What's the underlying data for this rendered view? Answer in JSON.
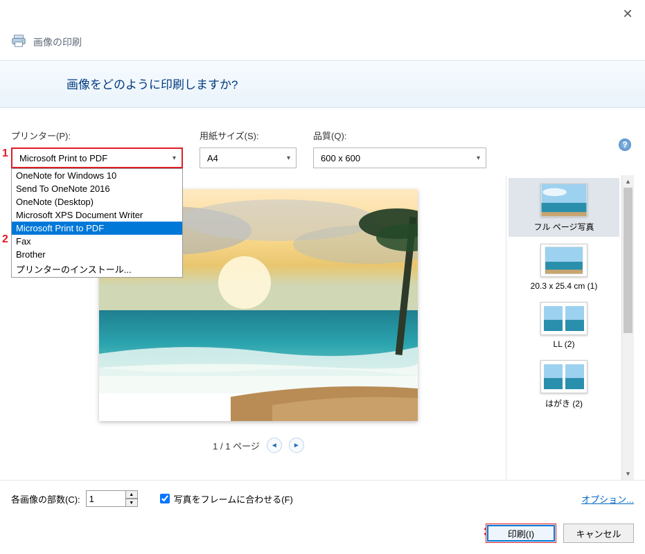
{
  "window": {
    "title": "画像の印刷",
    "question": "画像をどのように印刷しますか?"
  },
  "labels": {
    "printer": "プリンター(P):",
    "paper": "用紙サイズ(S):",
    "quality": "品質(Q):",
    "copies": "各画像の部数(C):",
    "fit": "写真をフレームに合わせる(F)",
    "options_link": "オプション...",
    "print_btn": "印刷(I)",
    "cancel_btn": "キャンセル",
    "page_text": "1 / 1 ページ"
  },
  "selections": {
    "printer": "Microsoft Print to PDF",
    "paper": "A4",
    "quality": "600 x 600",
    "copies": "1",
    "fit_checked": true
  },
  "printer_options": [
    "OneNote for Windows 10",
    "Send To OneNote 2016",
    "OneNote (Desktop)",
    "Microsoft XPS Document Writer",
    "Microsoft Print to PDF",
    "Fax",
    "Brother",
    "プリンターのインストール..."
  ],
  "templates": [
    {
      "label": "フル ページ写真"
    },
    {
      "label": "20.3 x 25.4 cm (1)"
    },
    {
      "label": "LL (2)"
    },
    {
      "label": "はがき (2)"
    }
  ],
  "annotations": {
    "a1": "1",
    "a2": "2",
    "a3": "3"
  }
}
